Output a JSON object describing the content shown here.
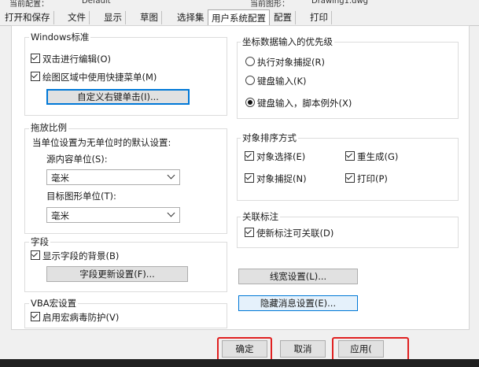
{
  "header": {
    "current_profile_label": "当前配置：",
    "current_profile_value": "Default",
    "current_drawing_label": "当前图形：",
    "current_drawing_value": "Drawing1.dwg"
  },
  "tabs": [
    {
      "label": "打开和保存"
    },
    {
      "label": "文件"
    },
    {
      "label": "显示"
    },
    {
      "label": "草图"
    },
    {
      "label": "选择集"
    },
    {
      "label": "用户系统配置"
    },
    {
      "label": "配置"
    },
    {
      "label": "打印"
    }
  ],
  "windows_std": {
    "title": "Windows标准",
    "double_click_edit": "双击进行编辑(O)",
    "shortcut_menu": "绘图区域中使用快捷菜单(M)",
    "right_click_button": "自定义右键单击(I)..."
  },
  "insert_scale": {
    "title": "拖放比例",
    "desc": "当单位设置为无单位时的默认设置:",
    "source_label": "源内容单位(S):",
    "source_value": "毫米",
    "target_label": "目标图形单位(T):",
    "target_value": "毫米"
  },
  "fields": {
    "title": "字段",
    "show_bg": "显示字段的背景(B)",
    "update_button": "字段更新设置(F)..."
  },
  "vba": {
    "title": "VBA宏设置",
    "virus_protect": "启用宏病毒防护(V)"
  },
  "coord_priority": {
    "title": "坐标数据输入的优先级",
    "opt_osnap": "执行对象捕捉(R)",
    "opt_keyboard": "键盘输入(K)",
    "opt_keyboard_except": "键盘输入，脚本例外(X)"
  },
  "sort": {
    "title": "对象排序方式",
    "select": "对象选择(E)",
    "regen": "重生成(G)",
    "snap": "对象捕捉(N)",
    "plot": "打印(P)"
  },
  "assoc": {
    "title": "关联标注",
    "new_assoc": "使新标注可关联(D)"
  },
  "lineweight_button": "线宽设置(L)...",
  "hidden_msg_button": "隐藏消息设置(E)...",
  "footer": {
    "ok": "确定",
    "cancel": "取消",
    "apply": "应用("
  }
}
